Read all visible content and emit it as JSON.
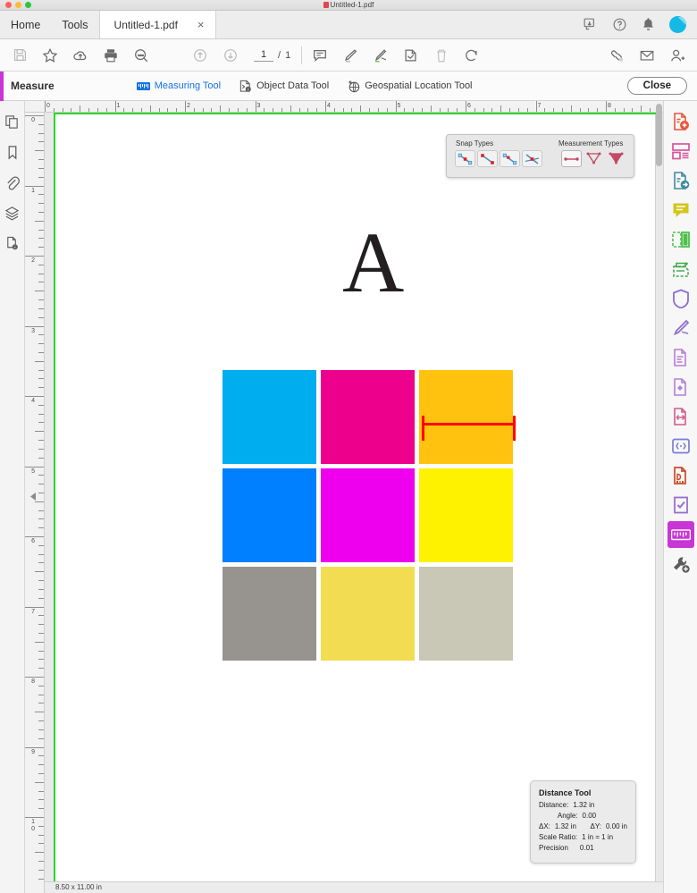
{
  "window": {
    "title": "Untitled-1.pdf",
    "file_icon": "pdf-file-icon"
  },
  "tabstrip": {
    "menus": [
      {
        "label": "Home",
        "name": "menu-home"
      },
      {
        "label": "Tools",
        "name": "menu-tools"
      }
    ],
    "document_tab": {
      "label": "Untitled-1.pdf",
      "close": "×"
    },
    "right_icons": [
      {
        "name": "share-icon"
      },
      {
        "name": "help-icon"
      },
      {
        "name": "notifications-bell-icon"
      },
      {
        "name": "user-avatar"
      }
    ]
  },
  "toolbar": {
    "left_tools": [
      {
        "name": "save-icon"
      },
      {
        "name": "star-favorite-icon"
      },
      {
        "name": "upload-cloud-icon"
      },
      {
        "name": "print-icon"
      },
      {
        "name": "zoom-search-icon"
      }
    ],
    "nav": {
      "prev_page_icon": "previous-page-icon",
      "next_page_icon": "next-page-icon",
      "page_current": "1",
      "page_separator": "/",
      "page_total": "1"
    },
    "annot_tools": [
      {
        "name": "comment-icon"
      },
      {
        "name": "highlight-pen-icon"
      },
      {
        "name": "signature-icon"
      },
      {
        "name": "stamp-icon"
      },
      {
        "name": "delete-trash-icon"
      },
      {
        "name": "rotate-icon"
      }
    ],
    "right_tools": [
      {
        "name": "link-cloud-icon"
      },
      {
        "name": "email-envelope-icon"
      },
      {
        "name": "add-person-icon"
      }
    ]
  },
  "measure_bar": {
    "title": "Measure",
    "tools": [
      {
        "label": "Measuring Tool",
        "name": "measuring-tool",
        "icon": "ruler-icon",
        "active": true
      },
      {
        "label": "Object Data Tool",
        "name": "object-data-tool",
        "icon": "object-data-icon",
        "active": false
      },
      {
        "label": "Geospatial Location Tool",
        "name": "geospatial-location-tool",
        "icon": "globe-icon",
        "active": false
      }
    ],
    "close_label": "Close"
  },
  "left_rail": [
    {
      "name": "sidebar-page-thumbnails-icon"
    },
    {
      "name": "sidebar-bookmarks-icon"
    },
    {
      "name": "sidebar-attachments-icon"
    },
    {
      "name": "sidebar-layers-icon"
    },
    {
      "name": "sidebar-document-info-icon"
    }
  ],
  "right_rail": [
    {
      "name": "tool-create-pdf-icon",
      "color": "#e8553a",
      "selected": false
    },
    {
      "name": "tool-organize-pages-icon",
      "color": "#d9539e",
      "selected": false
    },
    {
      "name": "tool-export-pdf-icon",
      "color": "#3f8ba0",
      "selected": false
    },
    {
      "name": "tool-comment-icon",
      "color": "#d4c519",
      "selected": false
    },
    {
      "name": "tool-combine-files-icon",
      "color": "#4cc14c",
      "selected": false
    },
    {
      "name": "tool-scan-ocr-icon",
      "color": "#3faa4a",
      "selected": false
    },
    {
      "name": "tool-protect-icon",
      "color": "#8b6fd0",
      "selected": false
    },
    {
      "name": "tool-fill-sign-icon",
      "color": "#8b6fd0",
      "selected": false
    },
    {
      "name": "tool-edit-pdf-icon",
      "color": "#b57fd6",
      "selected": false
    },
    {
      "name": "tool-redact-icon",
      "color": "#b57fd6",
      "selected": false
    },
    {
      "name": "tool-optimize-pdf-icon",
      "color": "#d05c8a",
      "selected": false
    },
    {
      "name": "tool-rich-media-icon",
      "color": "#7b7bdb",
      "selected": false
    },
    {
      "name": "tool-print-production-icon",
      "color": "#cc4a2a",
      "selected": false
    },
    {
      "name": "tool-preflight-icon",
      "color": "#9a6fd0",
      "selected": false
    },
    {
      "name": "tool-measure-icon",
      "color": "#ffffff",
      "selected": true
    },
    {
      "name": "tool-more-tools-icon",
      "color": "#5c5c5c",
      "selected": false
    }
  ],
  "rulers": {
    "unit": "in",
    "horizontal_labels": [
      "0",
      "1",
      "2",
      "3",
      "4",
      "5",
      "6",
      "7",
      "8"
    ],
    "vertical_labels": [
      "0",
      "1",
      "2",
      "3",
      "4",
      "5",
      "6",
      "7",
      "8",
      "9",
      "10"
    ]
  },
  "document": {
    "letter": "A",
    "page_size": "8.50 x 11.00 in",
    "swatches": [
      {
        "name": "swatch-cyan",
        "color": "#00ADEE"
      },
      {
        "name": "swatch-magenta",
        "color": "#EC008C"
      },
      {
        "name": "swatch-orange",
        "color": "#FFC20E"
      },
      {
        "name": "swatch-blue",
        "color": "#007FFF"
      },
      {
        "name": "swatch-pure-magenta",
        "color": "#EE00EE"
      },
      {
        "name": "swatch-yellow",
        "color": "#FFF200"
      },
      {
        "name": "swatch-gray",
        "color": "#97948F"
      },
      {
        "name": "swatch-gold",
        "color": "#F2DC52"
      },
      {
        "name": "swatch-beige",
        "color": "#C9C7B5"
      }
    ],
    "measurement_line_color": "#FF0000"
  },
  "snap_panel": {
    "snap_label": "Snap Types",
    "snap_buttons": [
      {
        "name": "snap-to-endpoints-icon"
      },
      {
        "name": "snap-to-midpoints-icon"
      },
      {
        "name": "snap-to-paths-icon"
      },
      {
        "name": "snap-to-intersections-icon"
      }
    ],
    "measurement_label": "Measurement Types",
    "measurement_buttons": [
      {
        "name": "distance-tool-icon",
        "selected": true
      },
      {
        "name": "perimeter-tool-icon",
        "selected": false
      },
      {
        "name": "area-tool-icon",
        "selected": false
      }
    ]
  },
  "distance_panel": {
    "title": "Distance Tool",
    "rows": [
      {
        "key": "Distance:",
        "value": "1.32 in"
      },
      {
        "key": "Angle:",
        "value": "0.00"
      },
      {
        "key": "ΔX:",
        "value": "1.32 in",
        "key2": "ΔY:",
        "value2": "0.00 in"
      },
      {
        "key": "Scale Ratio:",
        "value": "1 in = 1 in"
      },
      {
        "key": "Precision",
        "value": "0.01"
      }
    ]
  }
}
